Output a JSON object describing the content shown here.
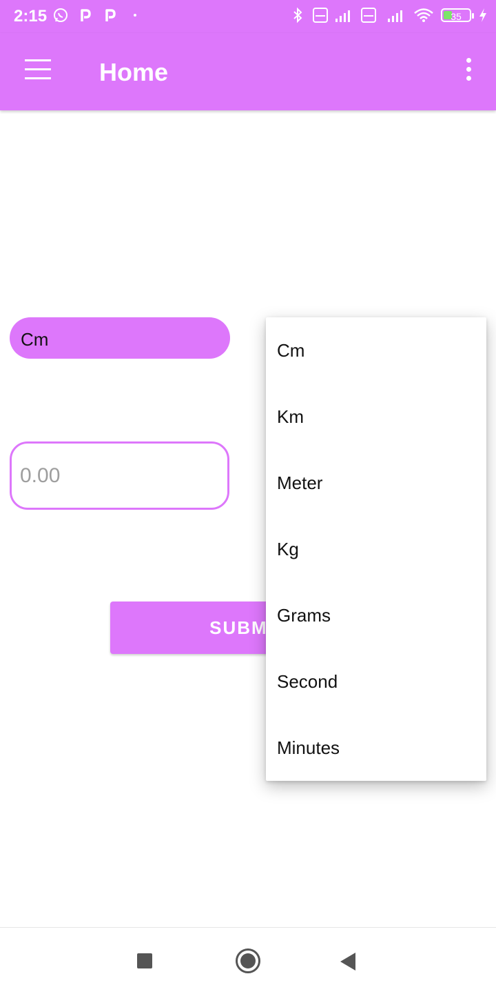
{
  "status_bar": {
    "time": "2:15",
    "battery_level": "35",
    "left_icons": [
      "whatsapp-icon",
      "p-app-icon",
      "p-app-icon",
      "dot-icon"
    ],
    "right_icons": [
      "bluetooth-icon",
      "volte-icon",
      "signal-icon",
      "volte-icon",
      "signal-4g-icon",
      "wifi-icon",
      "battery-icon",
      "charging-icon"
    ]
  },
  "app_bar": {
    "title": "Home",
    "color": "#dd77fb"
  },
  "unit_spinner": {
    "selected": "Cm"
  },
  "value_input": {
    "placeholder": "0.00",
    "value": ""
  },
  "submit": {
    "label": "SUBMIT"
  },
  "dropdown": {
    "options": [
      "Cm",
      "Km",
      "Meter",
      "Kg",
      "Grams",
      "Second",
      "Minutes"
    ]
  },
  "nav_bar": {
    "icons": [
      "recent-apps-icon",
      "home-icon",
      "back-icon"
    ]
  }
}
